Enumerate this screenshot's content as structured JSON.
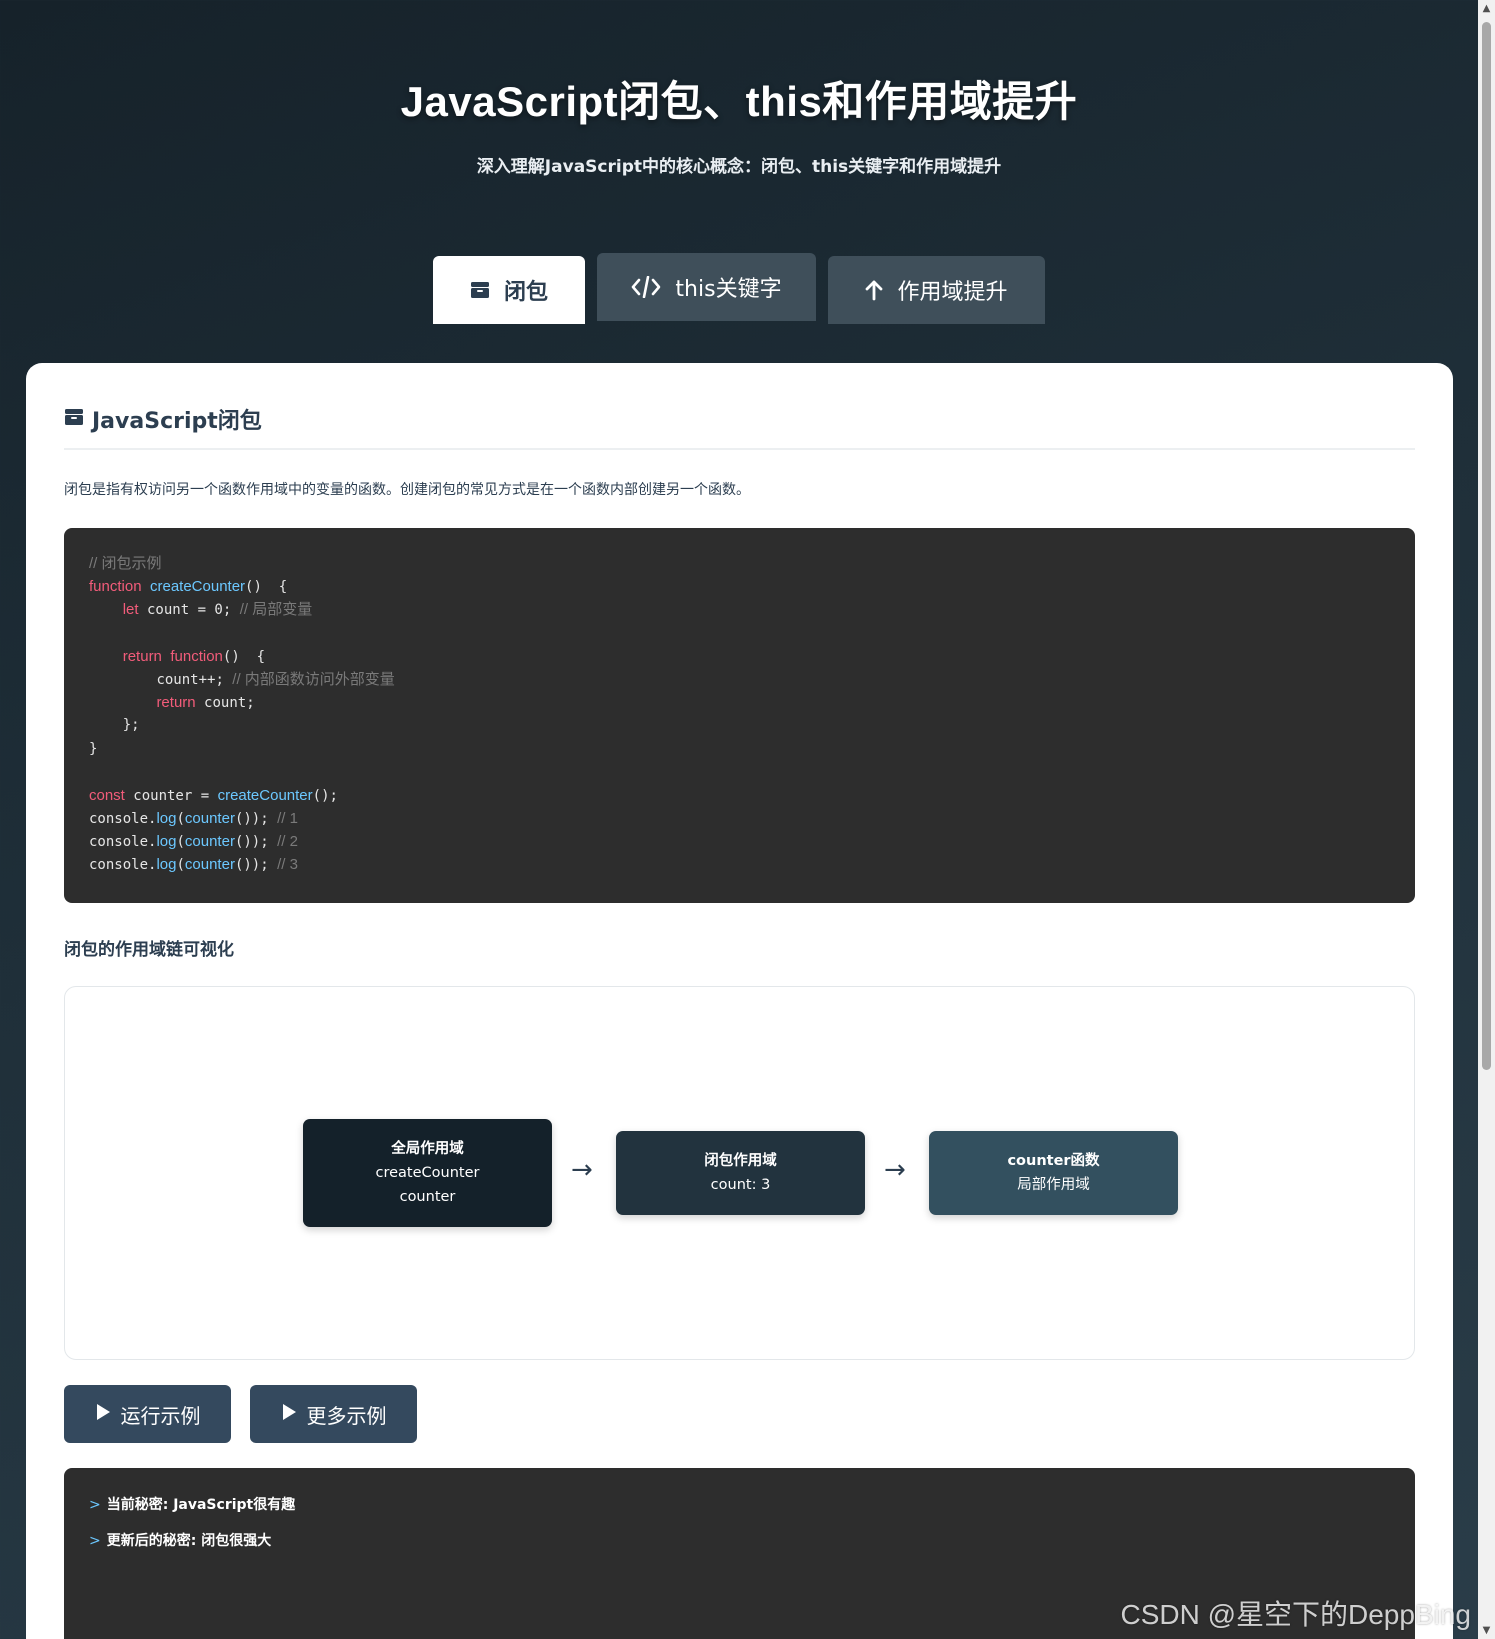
{
  "header": {
    "title": "JavaScript闭包、this和作用域提升",
    "subtitle": "深入理解JavaScript中的核心概念：闭包、this关键字和作用域提升"
  },
  "tabs": [
    {
      "label": "闭包",
      "icon": "box-icon",
      "active": true
    },
    {
      "label": "this关键字",
      "icon": "code-icon",
      "active": false
    },
    {
      "label": "作用域提升",
      "icon": "arrow-up-icon",
      "active": false
    }
  ],
  "section": {
    "title": "JavaScript闭包",
    "icon": "box-icon",
    "intro": "闭包是指有权访问另一个函数作用域中的变量的函数。创建闭包的常见方式是在一个函数内部创建另一个函数。"
  },
  "code": {
    "comment_title": "// 闭包示例",
    "l2_kw": "function",
    "l2_fn": "createCounter",
    "l2_rest": "()  {",
    "l3_kw": "let",
    "l3_rest": " count = 0; ",
    "l3_cm": "// 局部变量",
    "l5_kw1": "return",
    "l5_kw2": "function",
    "l5_rest": "()  {",
    "l6_rest": "count++; ",
    "l6_cm": "// 内部函数访问外部变量",
    "l7_kw": "return",
    "l7_rest": " count;",
    "l8_rest": "};",
    "l9_rest": "}",
    "l11_kw": "const",
    "l11_rest": " counter = ",
    "l11_fn": "createCounter",
    "l11_end": "();",
    "log_obj": "console.",
    "log_fn": "log",
    "log_open": "(",
    "log_arg": "counter",
    "log_close": "()); ",
    "log_c1": "// 1",
    "log_c2": "// 2",
    "log_c3": "// 3"
  },
  "visualization": {
    "title": "闭包的作用域链可视化",
    "arrow": "→",
    "nodes": {
      "global": {
        "head": "全局作用域",
        "line1": "createCounter",
        "line2": "counter"
      },
      "closure": {
        "head": "闭包作用域",
        "line1": "count: 3"
      },
      "counter": {
        "head": "counter函数",
        "line1": "局部作用域"
      }
    }
  },
  "buttons": {
    "run": "运行示例",
    "more": "更多示例"
  },
  "output": {
    "prompt": ">",
    "lines": [
      "当前秘密: JavaScript很有趣",
      "更新后的秘密: 闭包很强大"
    ]
  },
  "watermark": "CSDN @星空下的DeppBing",
  "colors": {
    "accent": "#34495e",
    "keyword": "#f25c7a",
    "function": "#6cc8ff",
    "comment": "#7a7a7a",
    "code_bg": "#2d2d2d"
  }
}
